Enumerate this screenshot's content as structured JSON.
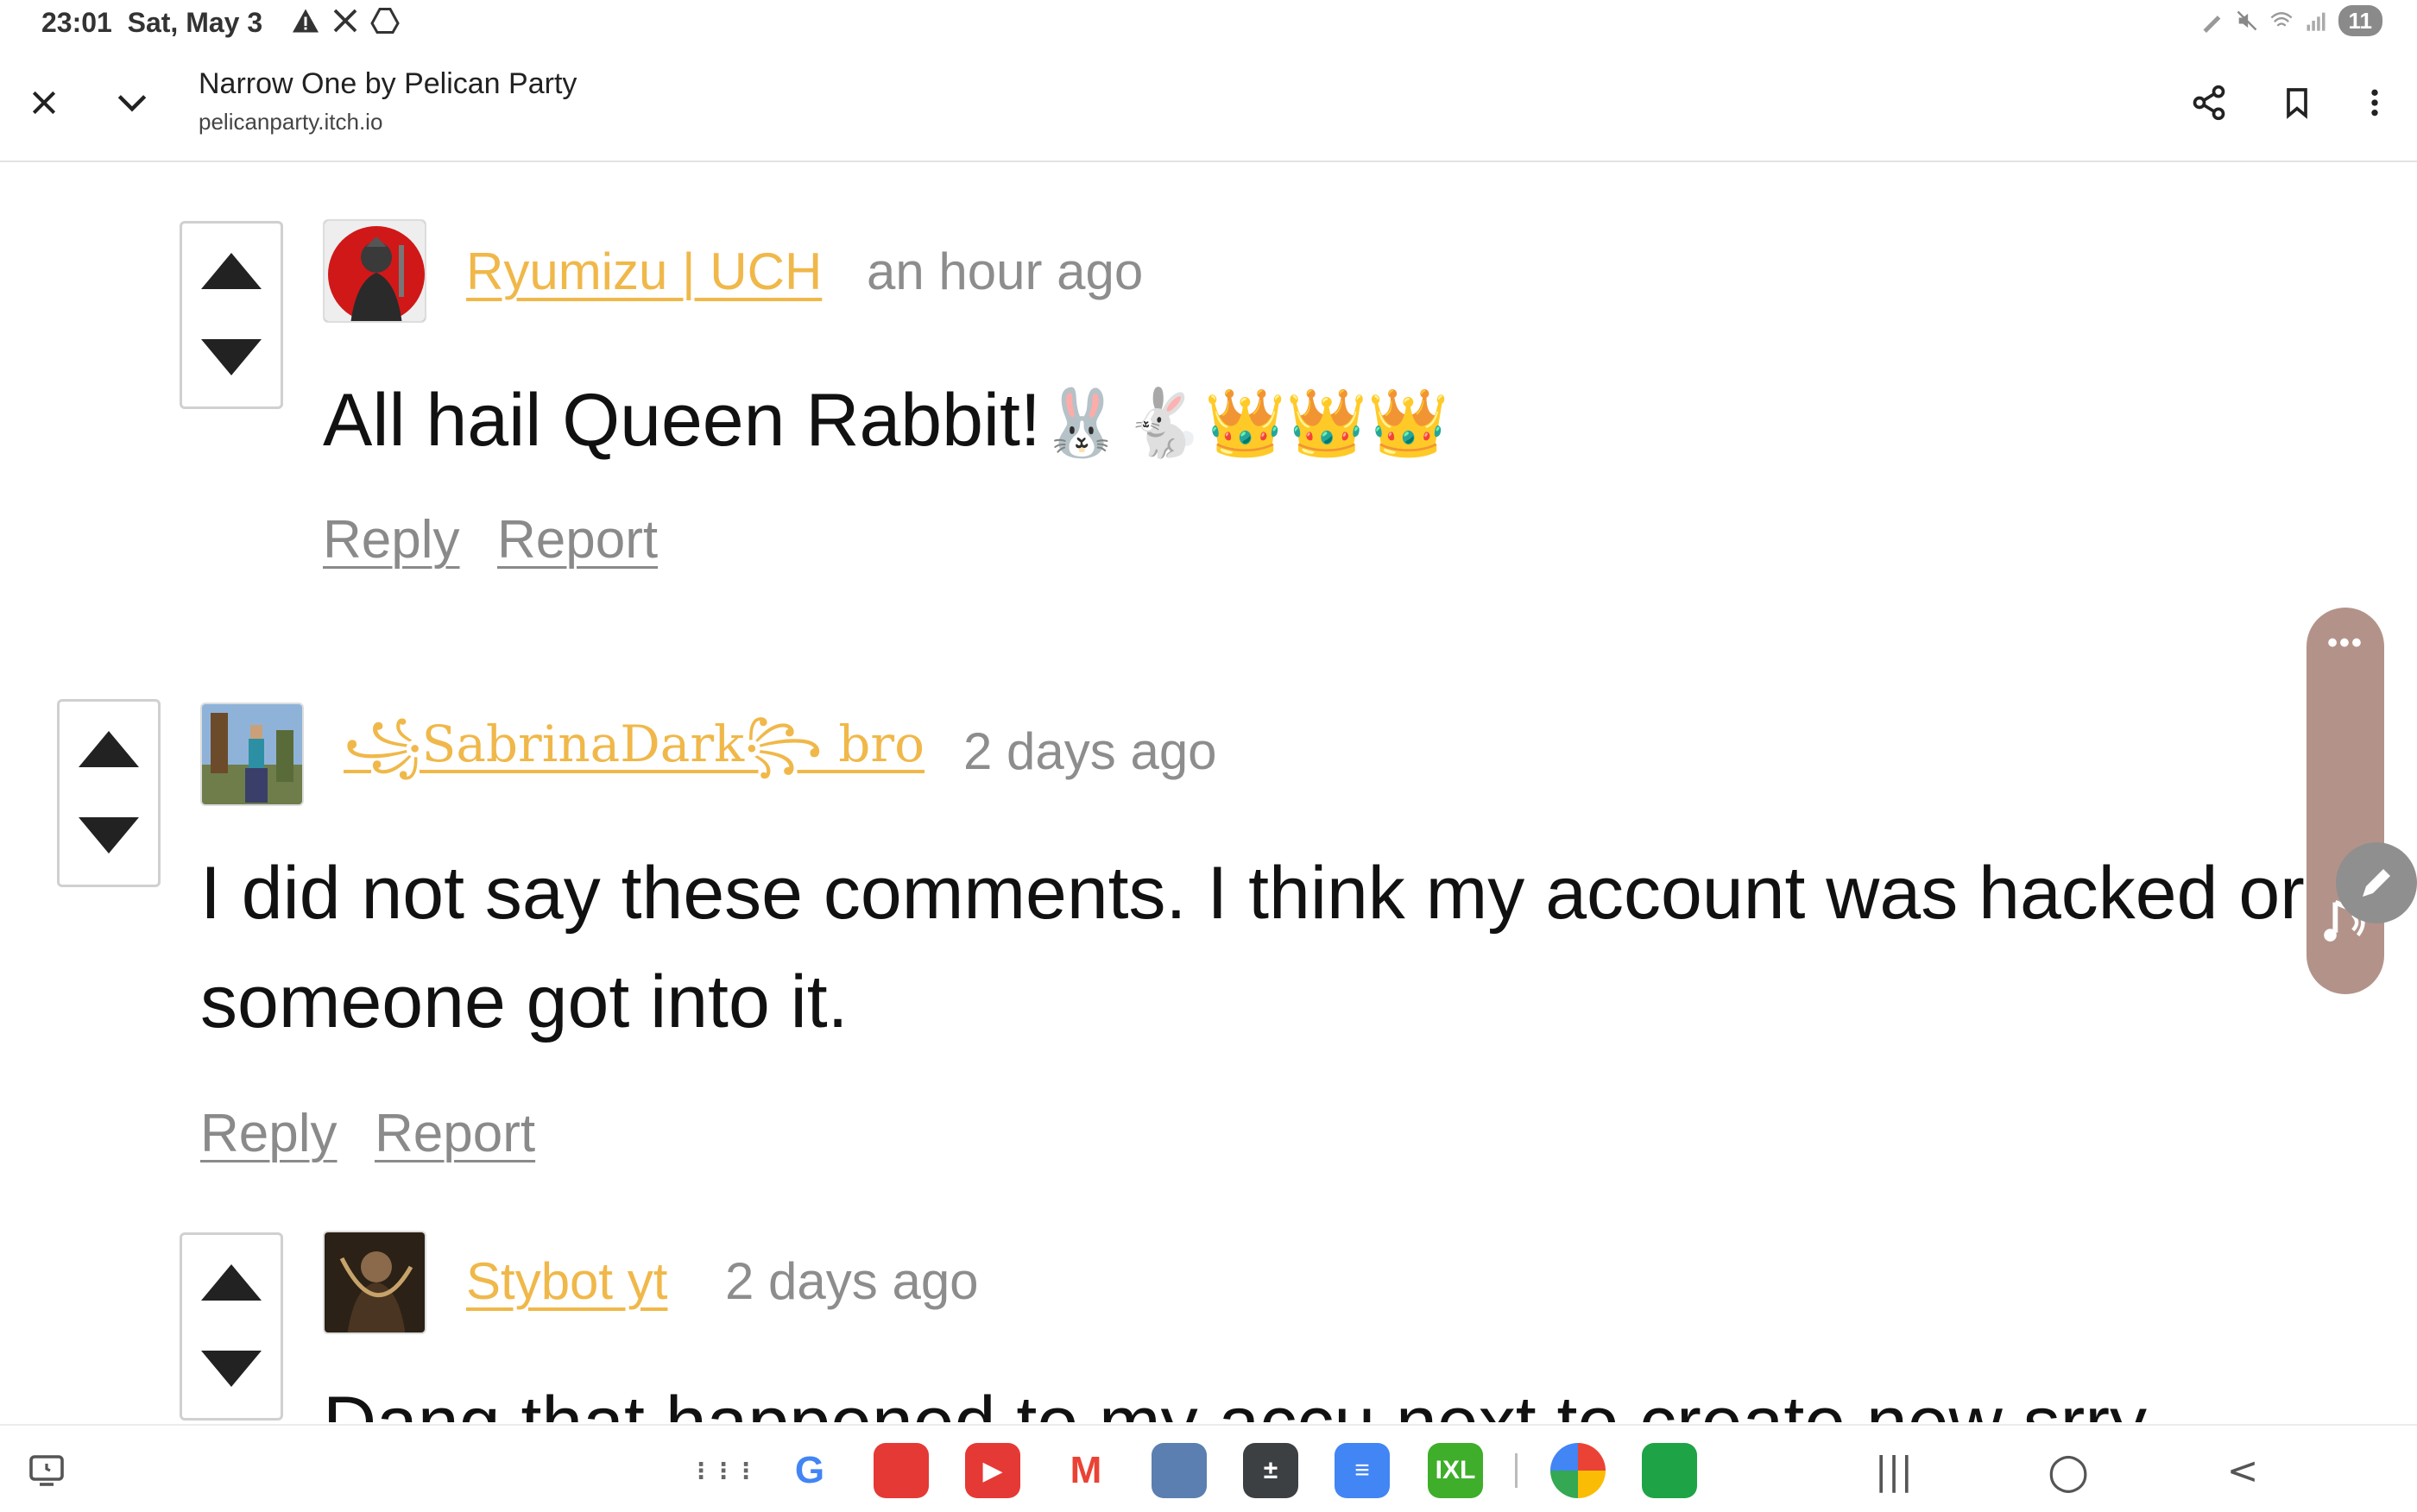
{
  "status_bar": {
    "time": "23:01",
    "date": "Sat, May 3",
    "battery": "11",
    "icons_left": [
      "alert-icon",
      "close-x-icon",
      "drive-icon"
    ],
    "icons_right": [
      "pen-icon",
      "mute-icon",
      "wifi-icon",
      "signal-icon"
    ]
  },
  "header": {
    "title": "Narrow One by Pelican Party",
    "url": "pelicanparty.itch.io",
    "buttons": [
      "close-icon",
      "chevron-down-icon",
      "share-icon",
      "bookmark-icon",
      "more-vert-icon"
    ]
  },
  "comments": [
    {
      "author": "Ryumizu | UCH",
      "time": "an hour ago",
      "text_lines": [
        "All hail Queen Rabbit!"
      ],
      "emoji": "🐰🐇👑👑👑",
      "reply": "Reply",
      "report": "Report"
    },
    {
      "author": "꧁SabrinaDark꧂ bro",
      "time": "2 days ago",
      "text_lines": [
        "I did not say these comments. I think my account was hacked or",
        "someone got into it."
      ],
      "reply": "Reply",
      "report": "Report"
    },
    {
      "author": "Stybot yt",
      "time": "2 days ago",
      "text_lines": [
        "Dang that happened to my accu next to create new srry"
      ]
    }
  ],
  "floating_panel": {
    "more_label": "•••",
    "icons": [
      "more-dots-icon",
      "music-note-icon",
      "pen-edit-icon"
    ]
  },
  "taskbar": {
    "left_icon": "recent-apps-clock-icon",
    "apps": [
      {
        "name": "app-drawer",
        "glyph": "⋮⋮⋮",
        "color": "#666666"
      },
      {
        "name": "google",
        "glyph": "G",
        "color": "#4285f4"
      },
      {
        "name": "notes",
        "glyph": "",
        "color": "#e53935"
      },
      {
        "name": "youtube-music",
        "glyph": "▶",
        "color": "#e53935"
      },
      {
        "name": "gmail",
        "glyph": "M",
        "color": "#ea4335"
      },
      {
        "name": "game",
        "glyph": "",
        "color": "#5a7fb0"
      },
      {
        "name": "calculator",
        "glyph": "±",
        "color": "#3c4043"
      },
      {
        "name": "docs",
        "glyph": "≡",
        "color": "#4285f4"
      },
      {
        "name": "ixl",
        "glyph": "IXL",
        "color": "#3fae2a"
      },
      {
        "name": "photos",
        "glyph": "",
        "color": "#fbbc05"
      },
      {
        "name": "classroom",
        "glyph": "",
        "color": "#1ea446"
      }
    ],
    "nav": {
      "recents": "|||",
      "home": "○",
      "back": "<"
    }
  },
  "colors": {
    "author_link": "#f0b84a",
    "time_text": "#8d8d8d",
    "action_link": "#8a8a8a",
    "body_text": "#111111",
    "vote_border": "#d0d0d0",
    "floating_panel": "#b39389"
  }
}
